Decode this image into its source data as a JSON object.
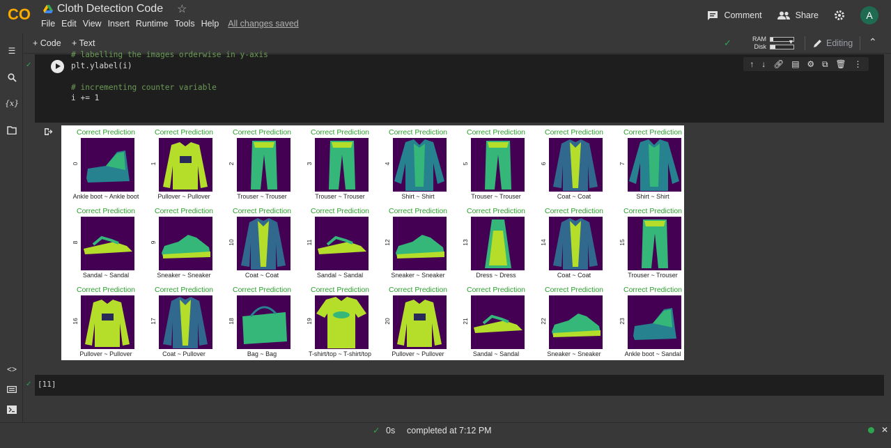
{
  "app": {
    "logo": "CO",
    "doc_title": "Cloth Detection Code",
    "star_icon": "star-icon"
  },
  "menu": [
    "File",
    "Edit",
    "View",
    "Insert",
    "Runtime",
    "Tools",
    "Help"
  ],
  "saved_status": "All changes saved",
  "header_right": {
    "comment": "Comment",
    "share": "Share",
    "avatar_letter": "A"
  },
  "toolbar": {
    "add_code": "+ Code",
    "add_text": "+ Text",
    "ram_label": "RAM",
    "disk_label": "Disk",
    "editing": "Editing"
  },
  "code_cell": {
    "lines": [
      {
        "kind": "cm",
        "text": "# labelling the images orderwise in y-axis"
      },
      {
        "kind": "tx",
        "text": "plt.ylabel(i)"
      },
      {
        "kind": "tx",
        "text": ""
      },
      {
        "kind": "cm",
        "text": "# incrementing counter variable"
      },
      {
        "kind": "tx",
        "text": "i += 1"
      }
    ]
  },
  "figure": {
    "prediction_text": "Correct Prediction",
    "prediction_color": "#2ca02c",
    "background_color": "#440154",
    "items": [
      {
        "idx": "0",
        "label": "Ankle boot ~ Ankle boot",
        "shape": "boot"
      },
      {
        "idx": "1",
        "label": "Pullover ~ Pullover",
        "shape": "sweater"
      },
      {
        "idx": "2",
        "label": "Trouser ~ Trouser",
        "shape": "trouser"
      },
      {
        "idx": "3",
        "label": "Trouser ~ Trouser",
        "shape": "trouser"
      },
      {
        "idx": "4",
        "label": "Shirt ~ Shirt",
        "shape": "shirt"
      },
      {
        "idx": "5",
        "label": "Trouser ~ Trouser",
        "shape": "trouser"
      },
      {
        "idx": "6",
        "label": "Coat ~ Coat",
        "shape": "coat"
      },
      {
        "idx": "7",
        "label": "Shirt ~ Shirt",
        "shape": "shirt"
      },
      {
        "idx": "8",
        "label": "Sandal ~ Sandal",
        "shape": "sandal"
      },
      {
        "idx": "9",
        "label": "Sneaker ~ Sneaker",
        "shape": "sneaker"
      },
      {
        "idx": "10",
        "label": "Coat ~ Coat",
        "shape": "coat"
      },
      {
        "idx": "11",
        "label": "Sandal ~ Sandal",
        "shape": "sandal"
      },
      {
        "idx": "12",
        "label": "Sneaker ~ Sneaker",
        "shape": "sneaker"
      },
      {
        "idx": "13",
        "label": "Dress ~ Dress",
        "shape": "dress"
      },
      {
        "idx": "14",
        "label": "Coat ~ Coat",
        "shape": "coat"
      },
      {
        "idx": "15",
        "label": "Trouser ~ Trouser",
        "shape": "trouser"
      },
      {
        "idx": "16",
        "label": "Pullover ~ Pullover",
        "shape": "sweater"
      },
      {
        "idx": "17",
        "label": "Coat ~ Pullover",
        "shape": "coat"
      },
      {
        "idx": "18",
        "label": "Bag ~ Bag",
        "shape": "bag"
      },
      {
        "idx": "19",
        "label": "T-shirt/top ~ T-shirt/top",
        "shape": "tshirt"
      },
      {
        "idx": "20",
        "label": "Pullover ~ Pullover",
        "shape": "sweater"
      },
      {
        "idx": "21",
        "label": "Sandal ~ Sandal",
        "shape": "sandal"
      },
      {
        "idx": "22",
        "label": "Sneaker ~ Sneaker",
        "shape": "sneaker"
      },
      {
        "idx": "23",
        "label": "Ankle boot ~ Sandal",
        "shape": "boot"
      }
    ]
  },
  "cell2": {
    "exec_count": "[11]"
  },
  "status": {
    "duration": "0s",
    "completed": "completed at 7:12 PM"
  }
}
